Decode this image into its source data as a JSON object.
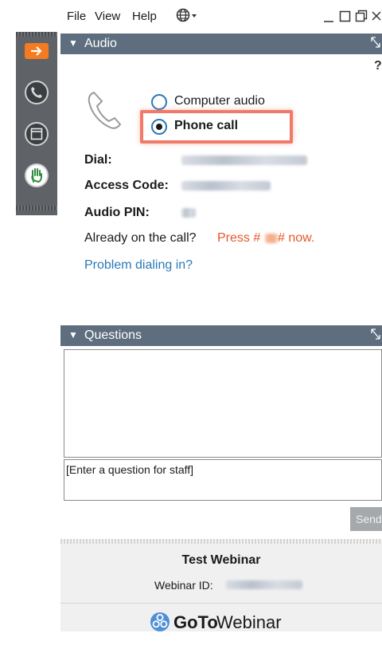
{
  "menubar": {
    "items": [
      "File",
      "View",
      "Help"
    ],
    "language_icon": "globe-icon",
    "window_controls": [
      "minimize-icon",
      "maximize-icon",
      "restore-icon",
      "close-icon"
    ]
  },
  "toolbar": {
    "buttons": [
      "arrow-right-icon",
      "phone-icon",
      "window-icon",
      "raise-hand-icon"
    ],
    "accent_color": "#f47b20"
  },
  "audio_panel": {
    "title": "Audio",
    "help": "?",
    "options": [
      {
        "label": "Computer audio",
        "selected": false
      },
      {
        "label": "Phone call",
        "selected": true
      }
    ],
    "dial_label": "Dial:",
    "access_code_label": "Access Code:",
    "audio_pin_label": "Audio PIN:",
    "already_on_call_text": "Already on the call?",
    "press_prefix": "Press #",
    "press_suffix": "# now.",
    "problem_link": "Problem dialing in?"
  },
  "questions_panel": {
    "title": "Questions",
    "input_value": "[Enter a question for staff]",
    "send_label": "Send"
  },
  "footer": {
    "webinar_title": "Test Webinar",
    "webinar_id_label": "Webinar ID:",
    "brand_goto": "GoTo",
    "brand_webinar": "Webinar"
  },
  "colors": {
    "panel_header": "#5e6e7e",
    "highlight_box": "#f07a6a",
    "link": "#2a7ab8",
    "press_text": "#e8572a"
  }
}
